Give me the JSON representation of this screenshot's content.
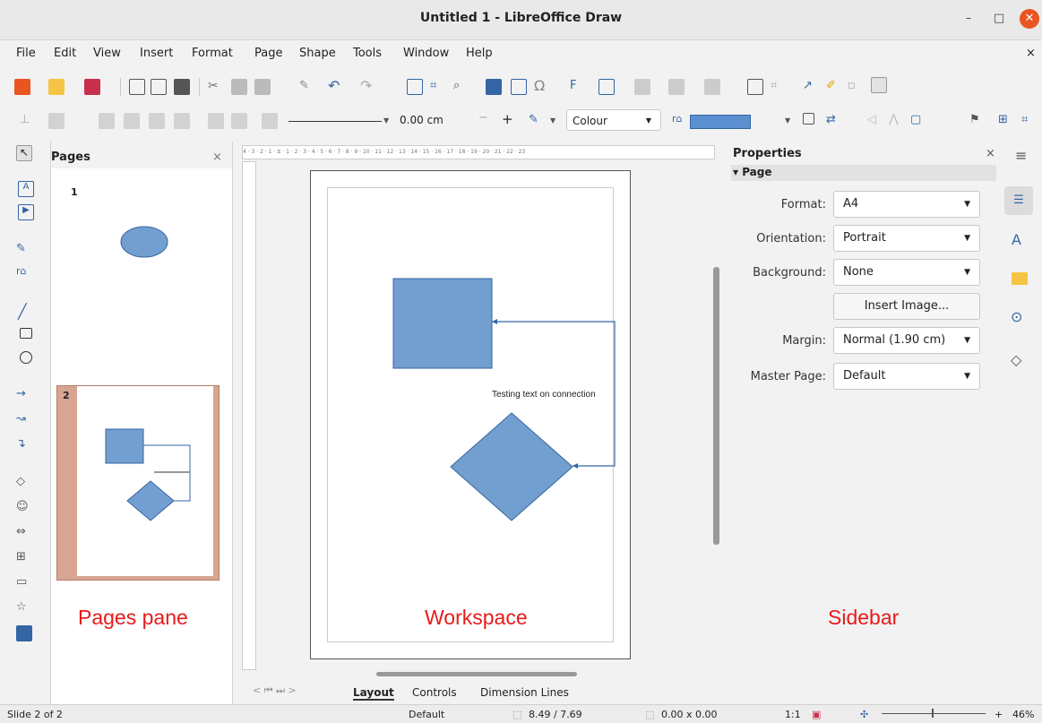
{
  "window": {
    "title": "Untitled 1 - LibreOffice Draw",
    "minimize": "–",
    "maximize": "□",
    "close": "✕"
  },
  "menu": [
    "File",
    "Edit",
    "View",
    "Insert",
    "Format",
    "Page",
    "Shape",
    "Tools",
    "Window",
    "Help"
  ],
  "menu_close": "×",
  "line_toolbar": {
    "width_value": "0.00 cm",
    "minus": "−",
    "plus": "+",
    "fill_label": "Colour"
  },
  "pages_pane": {
    "title": "Pages",
    "close": "×",
    "page1_number": "1",
    "page2_number": "2"
  },
  "workspace": {
    "ruler_h": "4 · 3 · 2 · 1 · ⧖ · 1 · 2 · 3 · 4 · 5 · 6 · 7 · 8 · 9 · 10 · 11 · 12 · 13 · 14 · 15 · 16 · 17 · 18 · 19 · 20 · 21 · 22 · 23",
    "connector_text": "Testing text on connection",
    "tabs": [
      "Layout",
      "Controls",
      "Dimension Lines"
    ],
    "active_tab": "Layout"
  },
  "sidebar": {
    "title": "Properties",
    "close": "×",
    "section": "Page",
    "format_label": "Format:",
    "format_value": "A4",
    "orientation_label": "Orientation:",
    "orientation_value": "Portrait",
    "background_label": "Background:",
    "background_value": "None",
    "insert_image": "Insert Image...",
    "margin_label": "Margin:",
    "margin_value": "Normal (1.90 cm)",
    "master_label": "Master Page:",
    "master_value": "Default"
  },
  "captions": {
    "pages": "Pages pane",
    "workspace": "Workspace",
    "sidebar": "Sidebar"
  },
  "status": {
    "slide": "Slide 2 of 2",
    "layout": "Default",
    "position": "8.49 / 7.69",
    "size": "0.00 x 0.00",
    "scale": "1:1",
    "zoom": "46%"
  },
  "colors": {
    "shape_fill": "#729fcf",
    "shape_stroke": "#3465a4",
    "accent": "#e95420"
  }
}
